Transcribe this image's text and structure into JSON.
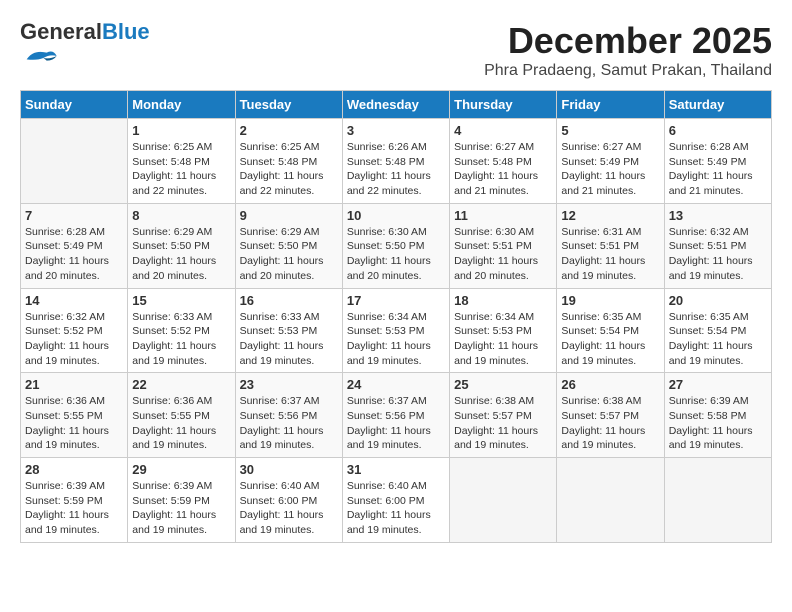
{
  "header": {
    "logo_general": "General",
    "logo_blue": "Blue",
    "month_title": "December 2025",
    "location": "Phra Pradaeng, Samut Prakan, Thailand"
  },
  "days_of_week": [
    "Sunday",
    "Monday",
    "Tuesday",
    "Wednesday",
    "Thursday",
    "Friday",
    "Saturday"
  ],
  "weeks": [
    [
      {
        "day": "",
        "empty": true
      },
      {
        "day": "1",
        "sunrise": "Sunrise: 6:25 AM",
        "sunset": "Sunset: 5:48 PM",
        "daylight": "Daylight: 11 hours and 22 minutes."
      },
      {
        "day": "2",
        "sunrise": "Sunrise: 6:25 AM",
        "sunset": "Sunset: 5:48 PM",
        "daylight": "Daylight: 11 hours and 22 minutes."
      },
      {
        "day": "3",
        "sunrise": "Sunrise: 6:26 AM",
        "sunset": "Sunset: 5:48 PM",
        "daylight": "Daylight: 11 hours and 22 minutes."
      },
      {
        "day": "4",
        "sunrise": "Sunrise: 6:27 AM",
        "sunset": "Sunset: 5:48 PM",
        "daylight": "Daylight: 11 hours and 21 minutes."
      },
      {
        "day": "5",
        "sunrise": "Sunrise: 6:27 AM",
        "sunset": "Sunset: 5:49 PM",
        "daylight": "Daylight: 11 hours and 21 minutes."
      },
      {
        "day": "6",
        "sunrise": "Sunrise: 6:28 AM",
        "sunset": "Sunset: 5:49 PM",
        "daylight": "Daylight: 11 hours and 21 minutes."
      }
    ],
    [
      {
        "day": "7",
        "sunrise": "Sunrise: 6:28 AM",
        "sunset": "Sunset: 5:49 PM",
        "daylight": "Daylight: 11 hours and 20 minutes."
      },
      {
        "day": "8",
        "sunrise": "Sunrise: 6:29 AM",
        "sunset": "Sunset: 5:50 PM",
        "daylight": "Daylight: 11 hours and 20 minutes."
      },
      {
        "day": "9",
        "sunrise": "Sunrise: 6:29 AM",
        "sunset": "Sunset: 5:50 PM",
        "daylight": "Daylight: 11 hours and 20 minutes."
      },
      {
        "day": "10",
        "sunrise": "Sunrise: 6:30 AM",
        "sunset": "Sunset: 5:50 PM",
        "daylight": "Daylight: 11 hours and 20 minutes."
      },
      {
        "day": "11",
        "sunrise": "Sunrise: 6:30 AM",
        "sunset": "Sunset: 5:51 PM",
        "daylight": "Daylight: 11 hours and 20 minutes."
      },
      {
        "day": "12",
        "sunrise": "Sunrise: 6:31 AM",
        "sunset": "Sunset: 5:51 PM",
        "daylight": "Daylight: 11 hours and 19 minutes."
      },
      {
        "day": "13",
        "sunrise": "Sunrise: 6:32 AM",
        "sunset": "Sunset: 5:51 PM",
        "daylight": "Daylight: 11 hours and 19 minutes."
      }
    ],
    [
      {
        "day": "14",
        "sunrise": "Sunrise: 6:32 AM",
        "sunset": "Sunset: 5:52 PM",
        "daylight": "Daylight: 11 hours and 19 minutes."
      },
      {
        "day": "15",
        "sunrise": "Sunrise: 6:33 AM",
        "sunset": "Sunset: 5:52 PM",
        "daylight": "Daylight: 11 hours and 19 minutes."
      },
      {
        "day": "16",
        "sunrise": "Sunrise: 6:33 AM",
        "sunset": "Sunset: 5:53 PM",
        "daylight": "Daylight: 11 hours and 19 minutes."
      },
      {
        "day": "17",
        "sunrise": "Sunrise: 6:34 AM",
        "sunset": "Sunset: 5:53 PM",
        "daylight": "Daylight: 11 hours and 19 minutes."
      },
      {
        "day": "18",
        "sunrise": "Sunrise: 6:34 AM",
        "sunset": "Sunset: 5:53 PM",
        "daylight": "Daylight: 11 hours and 19 minutes."
      },
      {
        "day": "19",
        "sunrise": "Sunrise: 6:35 AM",
        "sunset": "Sunset: 5:54 PM",
        "daylight": "Daylight: 11 hours and 19 minutes."
      },
      {
        "day": "20",
        "sunrise": "Sunrise: 6:35 AM",
        "sunset": "Sunset: 5:54 PM",
        "daylight": "Daylight: 11 hours and 19 minutes."
      }
    ],
    [
      {
        "day": "21",
        "sunrise": "Sunrise: 6:36 AM",
        "sunset": "Sunset: 5:55 PM",
        "daylight": "Daylight: 11 hours and 19 minutes."
      },
      {
        "day": "22",
        "sunrise": "Sunrise: 6:36 AM",
        "sunset": "Sunset: 5:55 PM",
        "daylight": "Daylight: 11 hours and 19 minutes."
      },
      {
        "day": "23",
        "sunrise": "Sunrise: 6:37 AM",
        "sunset": "Sunset: 5:56 PM",
        "daylight": "Daylight: 11 hours and 19 minutes."
      },
      {
        "day": "24",
        "sunrise": "Sunrise: 6:37 AM",
        "sunset": "Sunset: 5:56 PM",
        "daylight": "Daylight: 11 hours and 19 minutes."
      },
      {
        "day": "25",
        "sunrise": "Sunrise: 6:38 AM",
        "sunset": "Sunset: 5:57 PM",
        "daylight": "Daylight: 11 hours and 19 minutes."
      },
      {
        "day": "26",
        "sunrise": "Sunrise: 6:38 AM",
        "sunset": "Sunset: 5:57 PM",
        "daylight": "Daylight: 11 hours and 19 minutes."
      },
      {
        "day": "27",
        "sunrise": "Sunrise: 6:39 AM",
        "sunset": "Sunset: 5:58 PM",
        "daylight": "Daylight: 11 hours and 19 minutes."
      }
    ],
    [
      {
        "day": "28",
        "sunrise": "Sunrise: 6:39 AM",
        "sunset": "Sunset: 5:59 PM",
        "daylight": "Daylight: 11 hours and 19 minutes."
      },
      {
        "day": "29",
        "sunrise": "Sunrise: 6:39 AM",
        "sunset": "Sunset: 5:59 PM",
        "daylight": "Daylight: 11 hours and 19 minutes."
      },
      {
        "day": "30",
        "sunrise": "Sunrise: 6:40 AM",
        "sunset": "Sunset: 6:00 PM",
        "daylight": "Daylight: 11 hours and 19 minutes."
      },
      {
        "day": "31",
        "sunrise": "Sunrise: 6:40 AM",
        "sunset": "Sunset: 6:00 PM",
        "daylight": "Daylight: 11 hours and 19 minutes."
      },
      {
        "day": "",
        "empty": true
      },
      {
        "day": "",
        "empty": true
      },
      {
        "day": "",
        "empty": true
      }
    ]
  ]
}
